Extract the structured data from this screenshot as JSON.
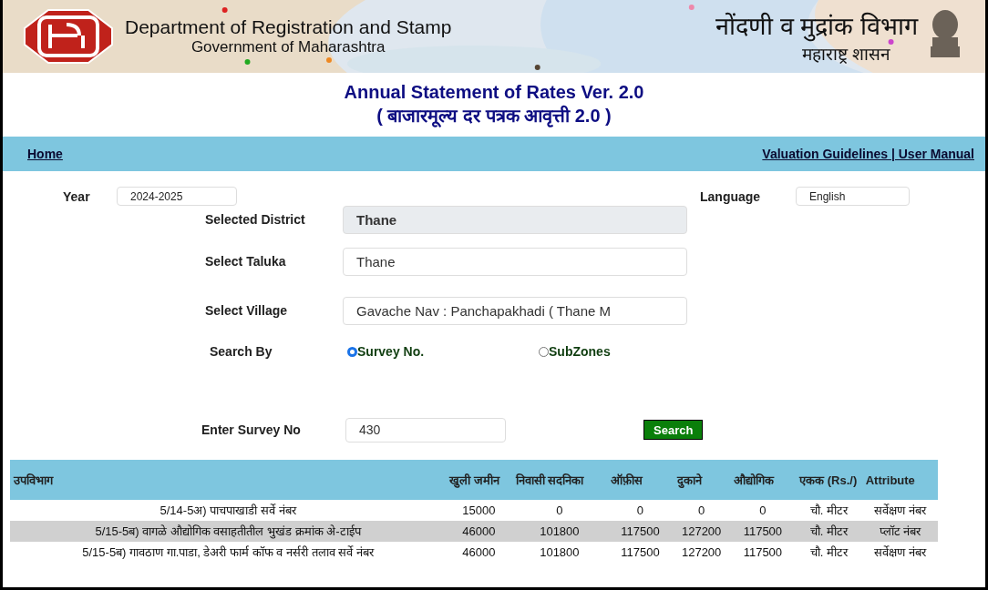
{
  "banner": {
    "title_en": "Department of Registration and Stamp",
    "subtitle_en": "Government of Maharashtra",
    "title_mr": "नोंदणी व मुद्रांक विभाग",
    "subtitle_mr": "महाराष्ट्र शासन"
  },
  "heading": {
    "title": "Annual Statement of Rates Ver. 2.0",
    "subtitle": "( बाजारमूल्य दर पत्रक आवृत्ती 2.0 )"
  },
  "nav": {
    "left": [
      "Home"
    ],
    "right": [
      "Valuation Guidelines | User Manual"
    ]
  },
  "year": {
    "label": "Year",
    "value": "2024-2025"
  },
  "language": {
    "label": "Language",
    "value": "English"
  },
  "fields": [
    {
      "label": "Selected District",
      "value": "Thane",
      "disabled": true
    },
    {
      "label": "Select Taluka",
      "value": "Thane",
      "disabled": false
    },
    {
      "label": "Select Village",
      "value": "Gavache Nav : Panchapakhadi ( Thane M",
      "disabled": false
    }
  ],
  "search_by": {
    "label": "Search By",
    "options": [
      {
        "label": "Survey No.",
        "selected": true
      },
      {
        "label": "SubZones",
        "selected": false
      }
    ]
  },
  "survey": {
    "label": "Enter Survey No",
    "value": "430",
    "button": "Search"
  },
  "table": {
    "columns": [
      "उपविभाग",
      "खुली जमीन",
      "निवासी सदनिका",
      "ऑफ़ीस",
      "दुकाने",
      "औद्योगिक",
      "एकक (Rs./)",
      "Attribute"
    ],
    "rows": [
      [
        "5/14-5अ) पाचपाखाडी सर्वे नंबर",
        "15000",
        "0",
        "0",
        "0",
        "0",
        "चौ. मीटर",
        "सर्वेक्षण नंबर"
      ],
      [
        "5/15-5ब) वागळे औद्योगिक वसाहतीतील भुखंड क्रमांक अे-टाईप",
        "46000",
        "101800",
        "117500",
        "127200",
        "117500",
        "चौ. मीटर",
        "प्लॉट नंबर"
      ],
      [
        "5/15-5ब) गावठाण गा.पाडा, डेअरी फार्म कॉफ व नर्सरी तलाव सर्वे नंबर",
        "46000",
        "101800",
        "117500",
        "127200",
        "117500",
        "चौ. मीटर",
        "सर्वेक्षण नंबर"
      ]
    ]
  }
}
